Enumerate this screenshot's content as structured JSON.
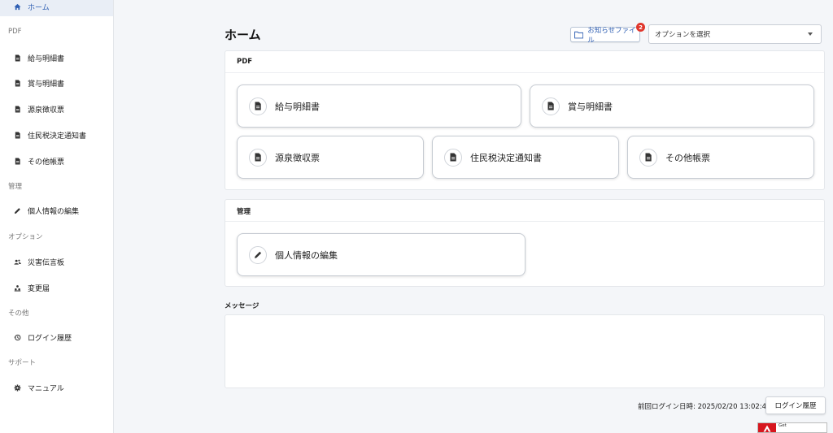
{
  "sidebar": {
    "home": "ホーム",
    "sections": [
      {
        "heading": "PDF",
        "items": [
          "給与明細書",
          "賞与明細書",
          "源泉徴収票",
          "住民税決定通知書",
          "その他帳票"
        ]
      },
      {
        "heading": "管理",
        "items": [
          "個人情報の編集"
        ]
      },
      {
        "heading": "オプション",
        "items": [
          "災害伝言板",
          "変更届"
        ]
      },
      {
        "heading": "その他",
        "items": [
          "ログイン履歴"
        ]
      },
      {
        "heading": "サポート",
        "items": [
          "マニュアル"
        ]
      }
    ]
  },
  "header": {
    "title": "ホーム",
    "notice_label": "お知らせファイル",
    "notice_count": "2",
    "option_select": "オプションを選択"
  },
  "pdf_section": {
    "title": "PDF",
    "buttons": [
      "給与明細書",
      "賞与明細書",
      "源泉徴収票",
      "住民税決定通知書",
      "その他帳票"
    ]
  },
  "admin_section": {
    "title": "管理",
    "buttons": [
      "個人情報の編集"
    ]
  },
  "messages": {
    "title": "メッセージ"
  },
  "footer": {
    "last_login": "前回ログイン日時: 2025/02/20 13:02:43",
    "login_history_button": "ログイン履歴"
  },
  "adobe": {
    "text": "Get"
  },
  "colors": {
    "accent": "#2f5fb3",
    "badge": "#e0362c",
    "active_bg": "#e9eef6"
  }
}
